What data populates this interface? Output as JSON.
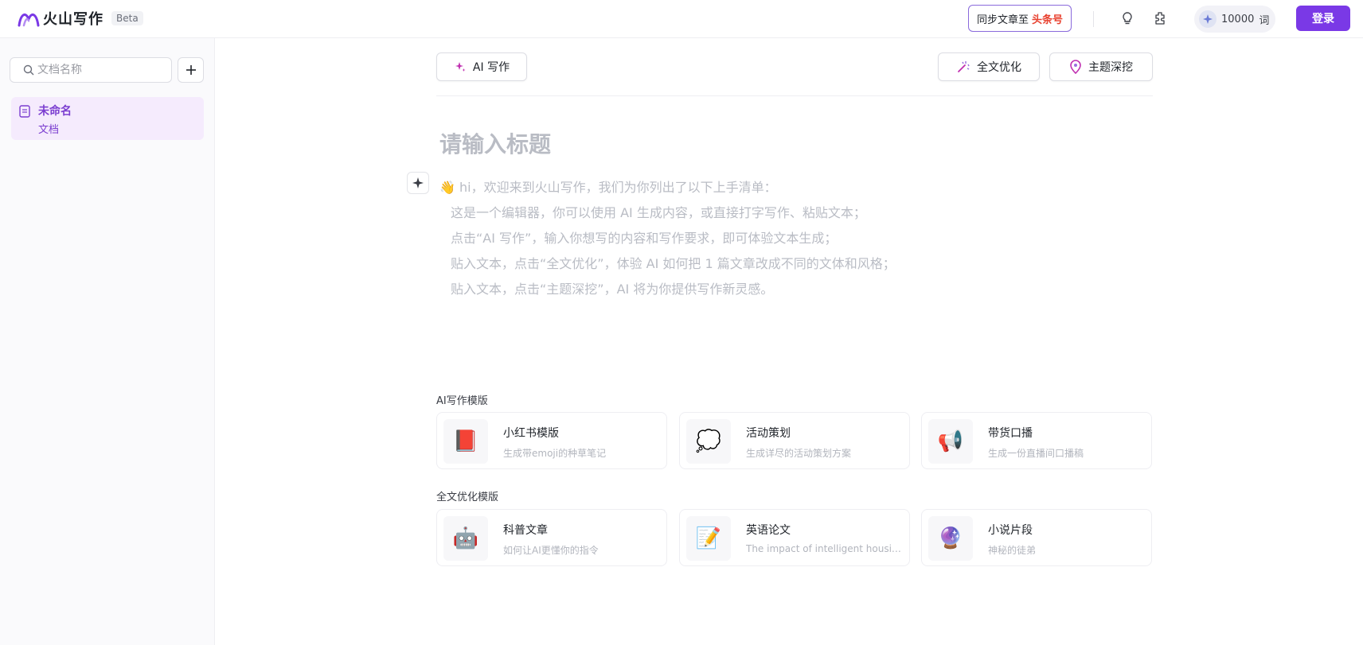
{
  "header": {
    "logo_text": "火山写作",
    "beta_label": "Beta",
    "sync_label": "同步文章至",
    "sync_brand": "头条号",
    "quota_value": "10000",
    "quota_unit": "词",
    "login_label": "登录",
    "accent_color": "#7a39e6"
  },
  "sidebar": {
    "search_placeholder": "文档名称",
    "add_icon": "plus-icon",
    "docs": [
      {
        "title": "未命名",
        "subtitle": "文档"
      }
    ]
  },
  "toolbar": {
    "ai_write": "AI 写作",
    "full_optimize": "全文优化",
    "topic_mining": "主题深挖"
  },
  "editor": {
    "title_placeholder": "请输入标题",
    "intro_lines": [
      "👋 hi，欢迎来到火山写作，我们为你列出了以下上手清单：",
      "这是一个编辑器，你可以使用 AI 生成内容，或直接打字写作、粘贴文本；",
      "点击“AI 写作”，输入你想写的内容和写作要求，即可体验文本生成；",
      "贴入文本，点击“全文优化”，体验 AI 如何把 1 篇文章改成不同的文体和风格；",
      "贴入文本，点击“主题深挖”，AI 将为你提供写作新灵感。"
    ]
  },
  "templates": {
    "ai_section_label": "AI写作模版",
    "ai_cards": [
      {
        "emoji": "📕",
        "title": "小红书模版",
        "desc": "生成带emoji的种草笔记"
      },
      {
        "emoji": "💭",
        "title": "活动策划",
        "desc": "生成详尽的活动策划方案"
      },
      {
        "emoji": "📢",
        "title": "带货口播",
        "desc": "生成一份直播间口播稿"
      }
    ],
    "opt_section_label": "全文优化模版",
    "opt_cards": [
      {
        "emoji": "🤖",
        "title": "科普文章",
        "desc": "如何让AI更懂你的指令"
      },
      {
        "emoji": "📝",
        "title": "英语论文",
        "desc": "The impact of intelligent housing on modern life"
      },
      {
        "emoji": "🔮",
        "title": "小说片段",
        "desc": "神秘的徒弟"
      }
    ]
  }
}
